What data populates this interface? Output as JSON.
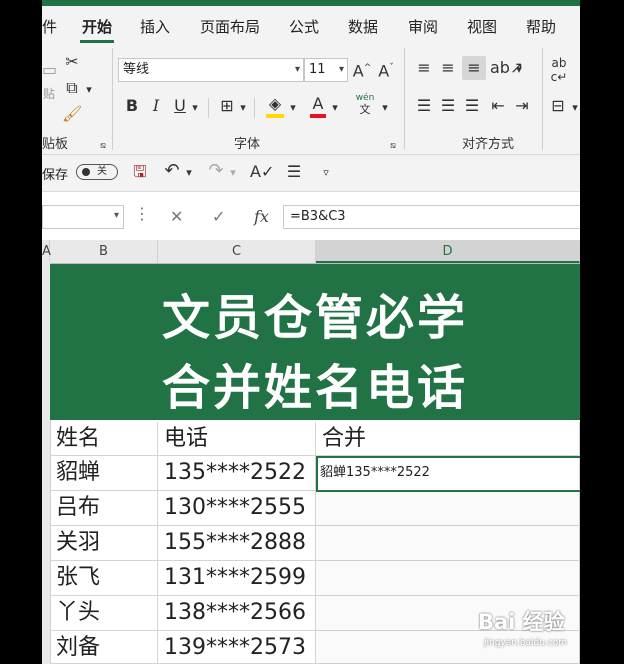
{
  "ribbon": {
    "tabs": [
      {
        "label": "件"
      },
      {
        "label": "开始"
      },
      {
        "label": "插入"
      },
      {
        "label": "页面布局"
      },
      {
        "label": "公式"
      },
      {
        "label": "数据"
      },
      {
        "label": "审阅"
      },
      {
        "label": "视图"
      },
      {
        "label": "帮助"
      }
    ],
    "active_tab": "开始",
    "font_name": "等线",
    "font_size": "11",
    "groups": {
      "clipboard": "贴板",
      "font": "字体",
      "alignment": "对齐方式"
    }
  },
  "qat": {
    "autosave_label": "保存",
    "autosave_state": "关"
  },
  "formula_bar": {
    "fx": "fx",
    "formula": "=B3&C3"
  },
  "columns": [
    "A",
    "B",
    "C",
    "D"
  ],
  "sheet": {
    "title_line1": "文员仓管必学",
    "title_line2": "合并姓名电话",
    "headers": {
      "name": "姓名",
      "phone": "电话",
      "merge": "合并"
    },
    "rows": [
      {
        "name": "貂蝉",
        "phone": "135****2522",
        "merge": "貂蝉135****2522"
      },
      {
        "name": "吕布",
        "phone": "130****2555",
        "merge": ""
      },
      {
        "name": "关羽",
        "phone": "155****2888",
        "merge": ""
      },
      {
        "name": "张飞",
        "phone": "131****2599",
        "merge": ""
      },
      {
        "name": "丫头",
        "phone": "138****2566",
        "merge": ""
      },
      {
        "name": "刘备",
        "phone": "139****2573",
        "merge": ""
      }
    ]
  },
  "colors": {
    "accent": "#217346"
  },
  "watermark": {
    "main": "Bai 经验",
    "sub": "jingyan.baidu.com"
  }
}
